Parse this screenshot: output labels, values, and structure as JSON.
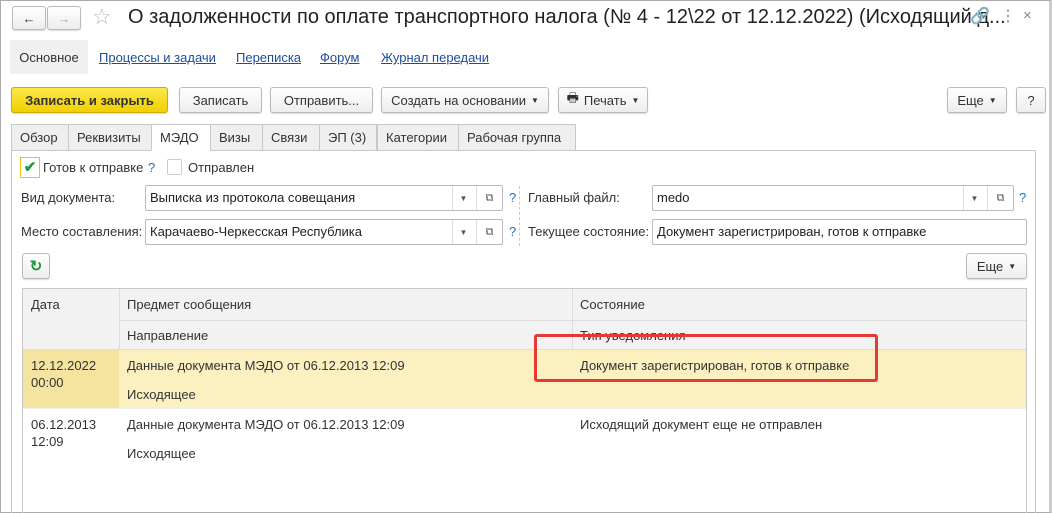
{
  "title": "О задолженности по оплате транспортного налога (№ 4 - 12\\22 от 12.12.2022) (Исходящий д...",
  "nav": {
    "main": "Основное",
    "links": [
      "Процессы и задачи",
      "Переписка",
      "Форум",
      "Журнал передачи"
    ]
  },
  "toolbar": {
    "save_close": "Записать и закрыть",
    "save": "Записать",
    "send": "Отправить...",
    "create_basis": "Создать на основании",
    "print": "Печать",
    "more": "Еще",
    "help": "?"
  },
  "tabs": [
    "Обзор",
    "Реквизиты",
    "МЭДО",
    "Визы",
    "Связи",
    "ЭП (3)",
    "Категории",
    "Рабочая группа"
  ],
  "form": {
    "ready_label": "Готов к отправке",
    "sent_label": "Отправлен",
    "help": "?",
    "doc_type_label": "Вид документа:",
    "doc_type": "Выписка из протокола совещания",
    "place_label": "Место составления:",
    "place": "Карачаево-Черкесская Республика",
    "main_file_label": "Главный файл:",
    "main_file": "medo",
    "state_label": "Текущее состояние:",
    "state": "Документ зарегистрирован, готов к отправке"
  },
  "table": {
    "more": "Еще",
    "headers": {
      "date": "Дата",
      "subject": "Предмет сообщения",
      "state": "Состояние",
      "direction": "Направление",
      "notify_type": "Тип уведомления"
    },
    "rows": [
      {
        "date": "12.12.2022",
        "time": "00:00",
        "subject": "Данные документа МЭДО от 06.12.2013 12:09",
        "direction": "Исходящее",
        "state": "Документ зарегистрирован, готов к отправке"
      },
      {
        "date": "06.12.2013",
        "time": "12:09",
        "subject": "Данные документа МЭДО от 06.12.2013 12:09",
        "direction": "Исходящее",
        "state": "Исходящий документ еще не отправлен"
      }
    ]
  },
  "colors": {
    "accent": "#f2cf00",
    "selected_row": "#fbf0c0",
    "highlight_box": "#e53935"
  }
}
